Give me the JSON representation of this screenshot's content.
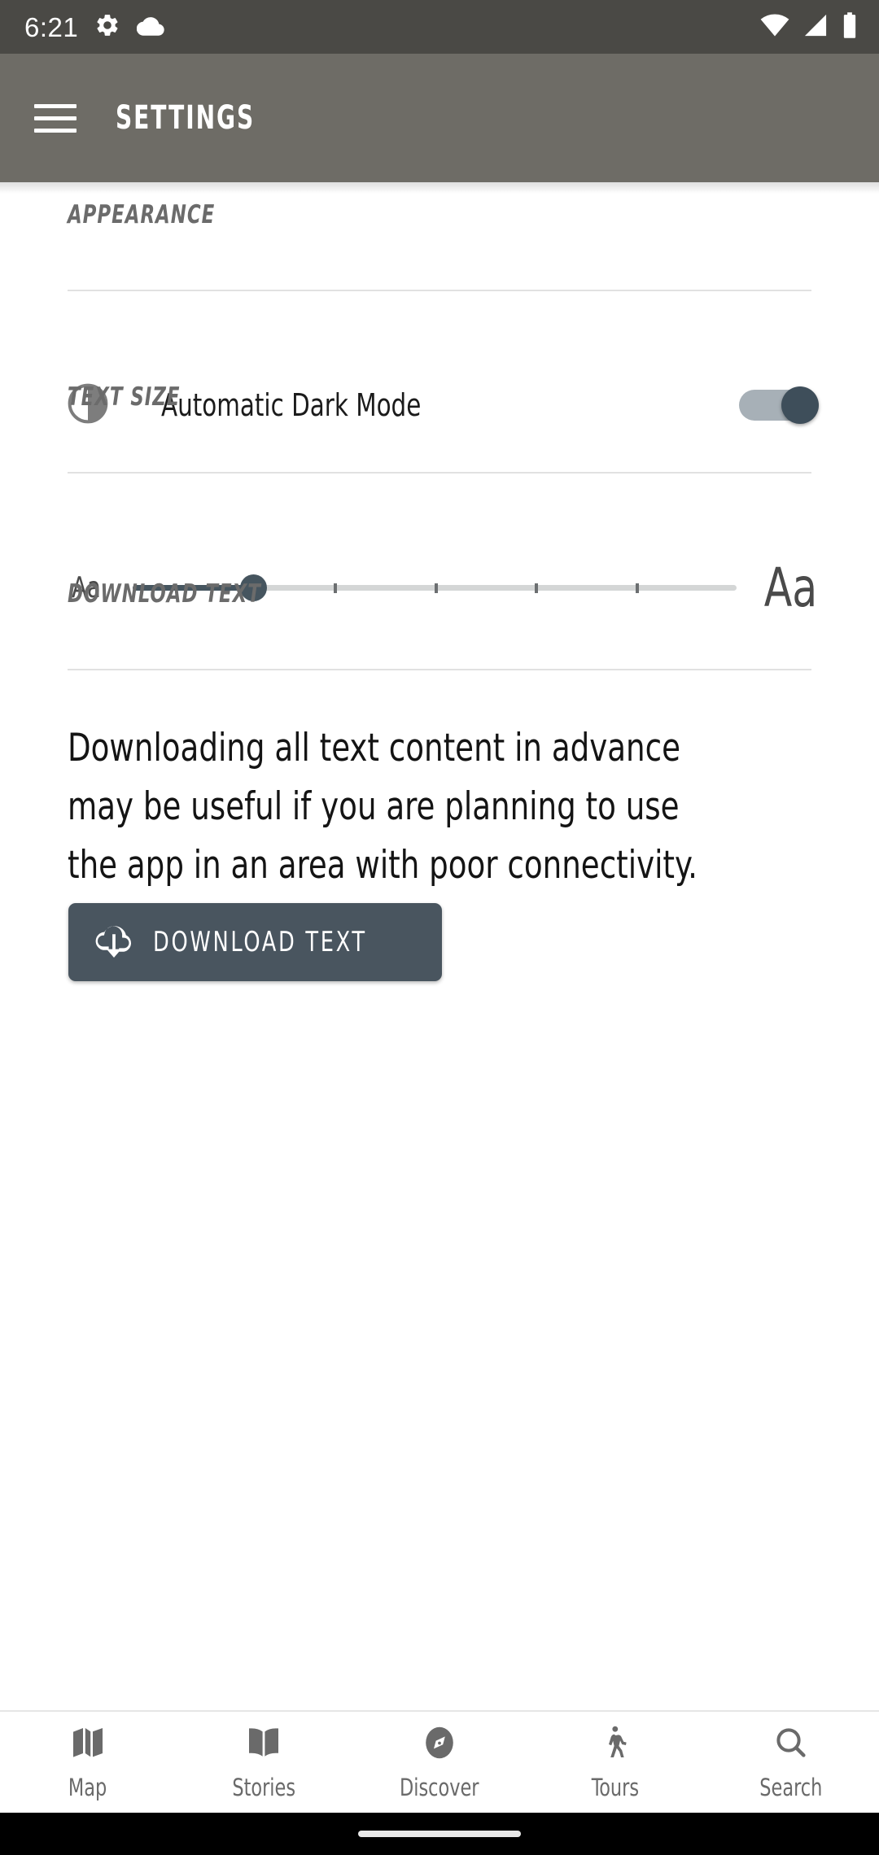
{
  "status_bar": {
    "time": "6:21",
    "left_icons": [
      "gear-icon",
      "cloud-icon"
    ],
    "right_icons": [
      "wifi-icon",
      "cellular-signal-icon",
      "battery-icon"
    ],
    "background_color": "#4a4945"
  },
  "app_bar": {
    "menu_icon": "hamburger-menu-icon",
    "title": "SETTINGS",
    "background_color": "#6e6c66",
    "text_color": "#ffffff"
  },
  "sections": {
    "appearance": {
      "header": "APPEARANCE",
      "dark_mode": {
        "icon": "brightness-contrast-icon",
        "label": "Automatic Dark Mode",
        "toggle_state": "on",
        "toggle_track_color": "#a7b0b7",
        "toggle_thumb_color": "#3e4e5a"
      }
    },
    "text_size": {
      "header": "TEXT SIZE",
      "small_label": "Aa",
      "large_label": "Aa",
      "slider": {
        "min": 0,
        "max": 5,
        "value": 1,
        "steps": 6,
        "fill_color": "#46555f",
        "rail_color": "#d4d6d6"
      }
    },
    "download_text": {
      "header": "DOWNLOAD TEXT",
      "description": "Downloading all text content in advance may be useful if you are planning to use the app in an area with poor connectivity.",
      "button": {
        "icon": "cloud-download-icon",
        "label": "DOWNLOAD TEXT",
        "background_color": "#49555f",
        "text_color": "#ffffff"
      }
    }
  },
  "bottom_nav": {
    "items": [
      {
        "label": "Map",
        "icon": "map-icon"
      },
      {
        "label": "Stories",
        "icon": "open-book-icon"
      },
      {
        "label": "Discover",
        "icon": "compass-icon"
      },
      {
        "label": "Tours",
        "icon": "walking-person-icon"
      },
      {
        "label": "Search",
        "icon": "search-icon"
      }
    ],
    "icon_color": "#6a6a6a"
  },
  "gesture_bar": {
    "background_color": "#000000",
    "pill_color": "#e8e8e8"
  }
}
